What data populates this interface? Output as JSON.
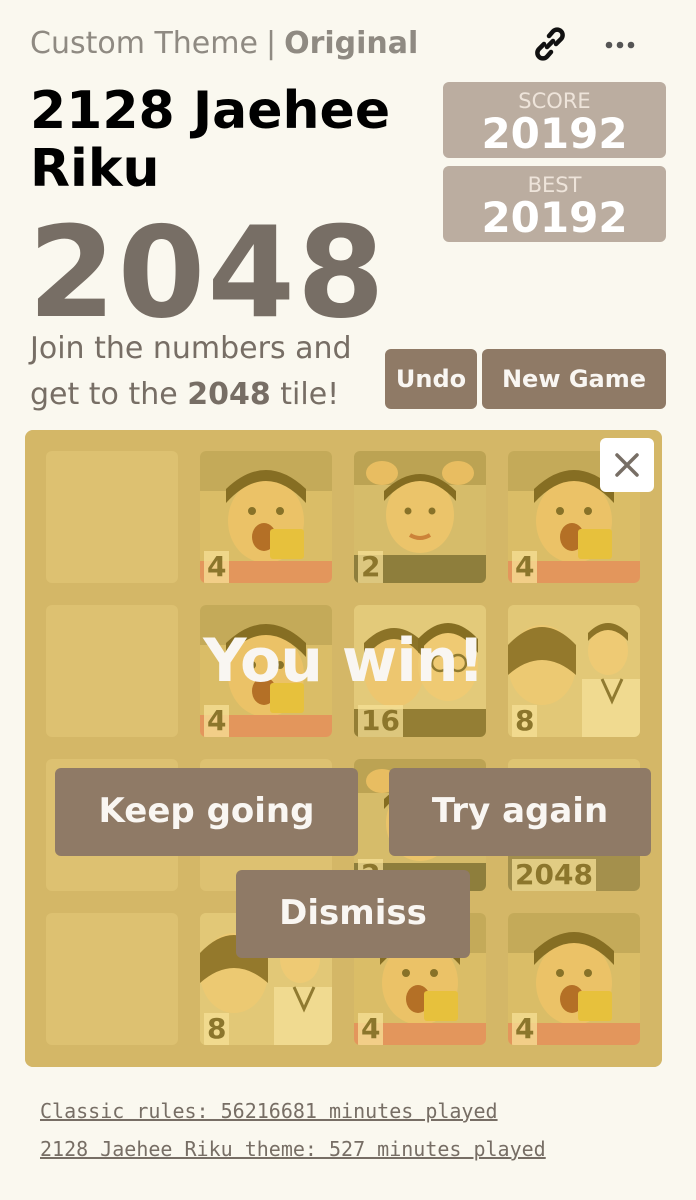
{
  "header": {
    "theme_label": "Custom Theme",
    "separator": "|",
    "original_label": "Original",
    "icons": [
      "link-icon",
      "more-icon"
    ],
    "theme_name": "2128 Jaehee Riku",
    "game_title": "2048"
  },
  "scores": {
    "score_label": "SCORE",
    "score_value": "20192",
    "best_label": "BEST",
    "best_value": "20192"
  },
  "intro": {
    "before": "Join the numbers and get to the ",
    "highlight": "2048",
    "after": " tile!"
  },
  "buttons": {
    "undo": "Undo",
    "new_game": "New Game"
  },
  "board": {
    "tiles": [
      {
        "label": "",
        "image": "empty-cell"
      },
      {
        "label": "4",
        "image": "child-open-mouth-photo"
      },
      {
        "label": "2",
        "image": "child-hands-on-head-photo"
      },
      {
        "label": "4",
        "image": "child-open-mouth-photo"
      },
      {
        "label": "",
        "image": "empty-cell"
      },
      {
        "label": "4",
        "image": "child-open-mouth-photo"
      },
      {
        "label": "16",
        "image": "two-children-photo"
      },
      {
        "label": "8",
        "image": "teen-in-uniform-photo"
      },
      {
        "label": "",
        "image": "empty-cell"
      },
      {
        "label": "",
        "image": "empty-cell"
      },
      {
        "label": "2",
        "image": "child-hands-on-head-photo"
      },
      {
        "label": "2048",
        "image": "group-photo"
      },
      {
        "label": "",
        "image": "empty-cell"
      },
      {
        "label": "8",
        "image": "teen-in-uniform-photo"
      },
      {
        "label": "4",
        "image": "child-open-mouth-photo"
      },
      {
        "label": "4",
        "image": "child-open-mouth-photo"
      }
    ]
  },
  "overlay": {
    "message": "You win!",
    "keep_going": "Keep going",
    "try_again": "Try again",
    "dismiss": "Dismiss",
    "close_icon": "close-icon"
  },
  "footer": {
    "classic": "Classic rules: 56216681 minutes played",
    "theme": "2128 Jaehee Riku theme: 527 minutes played"
  },
  "colors": {
    "background": "#faf8ef",
    "board": "#bbada0",
    "button": "#8f7a66",
    "win_overlay": "#edc22e"
  }
}
